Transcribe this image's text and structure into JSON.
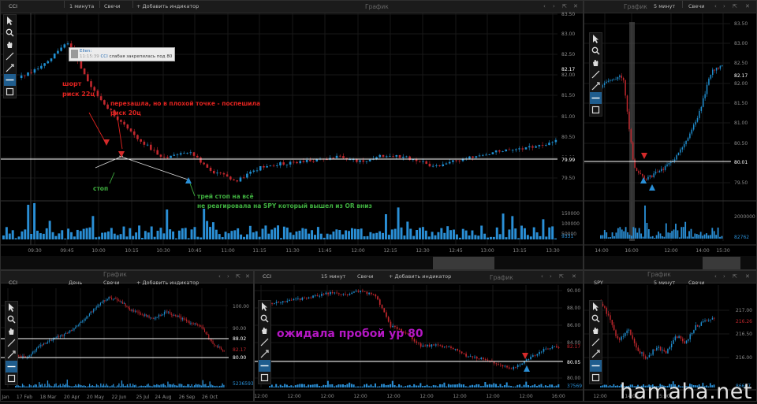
{
  "theme": {
    "up": "#1f8fd1",
    "down": "#c1272d",
    "level": "#ffffff",
    "volume": "#2a8fd6",
    "arrow_down": "#d42a2a",
    "arrow_up": "#2a8fd6"
  },
  "toolbar_icons": [
    "cursor-icon",
    "zoom-icon",
    "hand-icon",
    "line-tool-icon",
    "pen-icon",
    "horizontal-line-icon",
    "square-icon"
  ],
  "main": {
    "symbol": "CCI",
    "interval": "1 минута",
    "chart_type": "Свечи",
    "add_indicator": "+ Добавить индикатор",
    "title": "График",
    "window_controls": [
      "‹",
      "›",
      "⇱",
      "✕"
    ],
    "price_ticks": [
      "83.50",
      "83.00",
      "82.50",
      "82.00",
      "81.50",
      "81.00",
      "80.50",
      "80.00",
      "79.50"
    ],
    "last_price": "82.17",
    "level": "79.99",
    "volume_ticks": [
      "150000",
      "100000",
      "50000"
    ],
    "volume_last": "9331",
    "time_ticks": [
      "09:30",
      "09:45",
      "10:00",
      "10:15",
      "10:30",
      "10:45",
      "11:00",
      "11:15",
      "11:30",
      "11:45",
      "12:00",
      "12:15",
      "12:30",
      "12:45",
      "13:00",
      "13:15",
      "13:30"
    ],
    "annotations": {
      "short": "шорт\nриск 22ц",
      "reentry": "перезашла, но в плохой точке - поспешила\nриск 20ц",
      "stop": "стоп",
      "trail": "трей стоп на всё",
      "note": "не реагировала на SPY который вышел из OR вниз"
    },
    "message": {
      "name": "Ellen:",
      "time": "11:15:39",
      "symbol": "CCI",
      "text": "слабая закрепилась под 80"
    }
  },
  "topright": {
    "title": "График",
    "interval": "5 минут",
    "chart_type": "Свечи",
    "window_controls": [
      "‹",
      "›",
      "⇱",
      "✕"
    ],
    "price_ticks": [
      "83.50",
      "83.00",
      "82.50",
      "82.00",
      "81.50",
      "81.00",
      "80.50",
      "80.00",
      "79.50"
    ],
    "last_price": "82.17",
    "level": "80.01",
    "volume_ticks": [
      "2000000"
    ],
    "volume_last": "82762",
    "time_ticks": [
      "14:00",
      "16:00",
      "12:00",
      "14:00",
      "15:30"
    ]
  },
  "daily": {
    "title": "График",
    "symbol": "CCI",
    "interval": "День",
    "chart_type": "Свечи",
    "add_indicator": "+ Добавить индикатор",
    "window_controls": [
      "‹",
      "›",
      "⇱",
      "✕"
    ],
    "price_ticks": [
      "100.00",
      "90.00"
    ],
    "levels": [
      "88.02",
      "80.00"
    ],
    "last_price": "82.17",
    "volume_last": "5236593",
    "time_ticks": [
      "Jan",
      "17 Feb",
      "18 Mar",
      "20 Apr",
      "20 May",
      "22 Jun",
      "25 Jul",
      "24 Aug",
      "26 Sep",
      "26 Oct"
    ]
  },
  "m15": {
    "title": "График",
    "symbol": "CCI",
    "interval": "15 минут",
    "chart_type": "Свечи",
    "add_indicator": "+ Добавить индикатор",
    "window_controls": [
      "‹",
      "›",
      "⇱",
      "✕"
    ],
    "price_ticks": [
      "90.00",
      "88.00",
      "86.00",
      "84.00",
      "82.00",
      "80.00"
    ],
    "last_price": "82.17",
    "level": "80.05",
    "volume_last": "37569",
    "time_ticks": [
      "12:00",
      "12:00",
      "12:00",
      "12:00",
      "12:00",
      "12:00",
      "12:00",
      "12:00",
      "12:00",
      "16:00"
    ],
    "annotation": "ожидала пробой ур 80"
  },
  "spy": {
    "title": "График",
    "symbol": "SPY",
    "interval": "5 минут",
    "chart_type": "Свечи",
    "window_controls": [
      "‹",
      "›",
      "⇱",
      "✕"
    ],
    "price_ticks": [
      "217.00",
      "216.50",
      "216.00"
    ],
    "last_price": "216.26",
    "volume_last": "86667",
    "time_ticks": [
      "12:00",
      "14:00",
      "15:00"
    ]
  },
  "watermark": "hamaha.net"
}
